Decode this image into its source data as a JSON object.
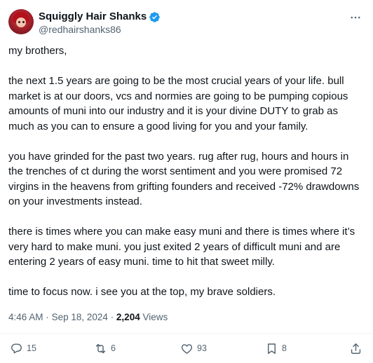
{
  "author": {
    "display_name": "Squiggly Hair Shanks",
    "handle": "@redhairshanks86",
    "verified": true,
    "verified_color": "#1d9bf0",
    "avatar_icon": "avatar-red-hair"
  },
  "tweet": {
    "paragraphs": [
      "my brothers,",
      "the next 1.5 years are going to be the most crucial years of your life. bull market is at our doors, vcs and normies are going to be pumping copious amounts of muni into our industry and it is your divine DUTY to grab as much as you can to ensure a good living for you and your family.",
      "you have grinded for the past two years. rug after rug, hours and hours in the trenches of ct during the worst sentiment and you were promised 72 virgins in the heavens from grifting founders and received -72% drawdowns on your investments instead.",
      "there is times where you can make easy muni and there is times where it’s very hard to make muni. you just exited 2 years of difficult muni and are entering 2 years of easy muni. time to hit that sweet milly.",
      "time to focus now. i see you at the top, my brave soldiers."
    ]
  },
  "meta": {
    "time": "4:46 AM",
    "separator": "·",
    "date": "Sep 18, 2024",
    "views_count": "2,204",
    "views_label": "Views"
  },
  "actions": {
    "replies": "15",
    "reposts": "6",
    "likes": "93",
    "bookmarks": "8"
  }
}
